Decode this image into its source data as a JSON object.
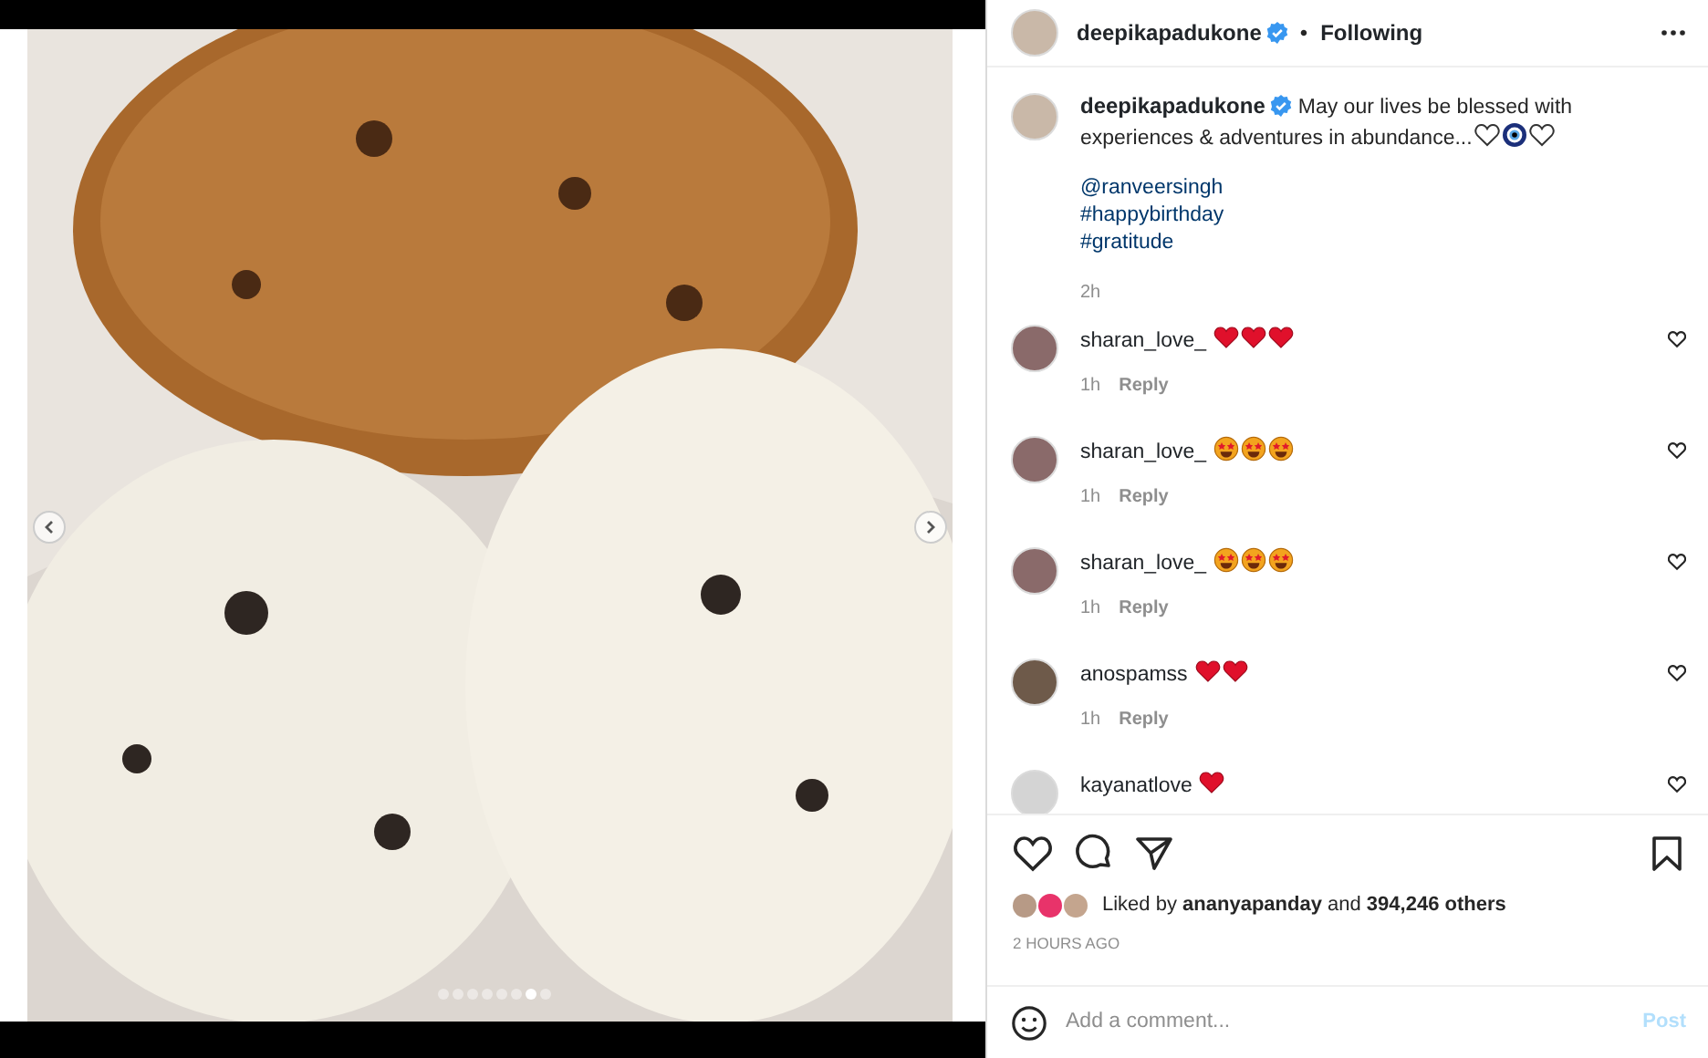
{
  "photo": {
    "carousel_dots": [
      {
        "selected": false
      },
      {
        "selected": false
      },
      {
        "selected": false
      },
      {
        "selected": false
      },
      {
        "selected": false
      },
      {
        "selected": false
      },
      {
        "selected": true
      },
      {
        "selected": false
      }
    ]
  },
  "header": {
    "username": "deepikapadukone",
    "verified": true,
    "separator": "•",
    "follow_status": "Following"
  },
  "caption": {
    "username": "deepikapadukone",
    "verified": true,
    "text": "May our lives be blessed with experiences & adventures in abundance...",
    "emoji": [
      {
        "kind": "outline-heart"
      },
      {
        "kind": "evil-eye"
      },
      {
        "kind": "outline-heart"
      }
    ],
    "tags": [
      "@ranveersingh",
      "#happybirthday",
      "#gratitude"
    ],
    "time": "2h"
  },
  "comments": [
    {
      "username": "sharan_love_",
      "emoji": [
        {
          "kind": "heart"
        },
        {
          "kind": "heart"
        },
        {
          "kind": "heart"
        }
      ],
      "time": "1h",
      "reply": "Reply"
    },
    {
      "username": "sharan_love_",
      "emoji": [
        {
          "kind": "star-eyes"
        },
        {
          "kind": "star-eyes"
        },
        {
          "kind": "star-eyes"
        }
      ],
      "time": "1h",
      "reply": "Reply"
    },
    {
      "username": "sharan_love_",
      "emoji": [
        {
          "kind": "star-eyes"
        },
        {
          "kind": "star-eyes"
        },
        {
          "kind": "star-eyes"
        }
      ],
      "time": "1h",
      "reply": "Reply"
    },
    {
      "username": "anospamss",
      "emoji": [
        {
          "kind": "heart"
        },
        {
          "kind": "heart"
        }
      ],
      "time": "1h",
      "reply": "Reply"
    },
    {
      "username": "kayanatlove",
      "emoji": [
        {
          "kind": "heart"
        }
      ]
    }
  ],
  "likes": {
    "text": "Liked by **ananyapanday** and **394,246 others**"
  },
  "timestamp": "2 HOURS AGO",
  "comment_box": {
    "placeholder": "Add a comment...",
    "post_label": "Post"
  }
}
